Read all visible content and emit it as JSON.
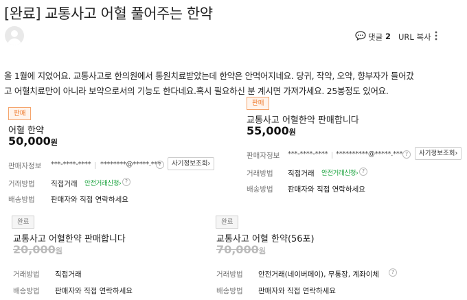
{
  "post": {
    "title": "[완료] 교통사고 어혈 풀어주는 한약",
    "body_line1": "올 1월에 지었어요. 교통사고로 한의원에서 통원치료받았는데 한약은 안먹어지네요. 당귀, 작약, 오약, 향부자가 들어갔",
    "body_line2": "고 어혈치료만이 아니라 보약으로서의 기능도 한다네요.혹시 필요하신 분 계시면 가져가세요. 25봉정도 있어요."
  },
  "toolbar": {
    "comment_label": "댓글",
    "comment_count": "2",
    "url_copy": "URL 복사"
  },
  "labels": {
    "seller_info": "판매자정보",
    "trade_method": "거래방법",
    "delivery_method": "배송방법",
    "fraud_check": "사기정보조회",
    "safe_trade": "안전거래신청",
    "won": "원",
    "help": "?"
  },
  "cards": [
    {
      "badge": "판매",
      "name": "어혈 한약",
      "price": "50,000",
      "seller_phone": "***-****-****",
      "seller_email": "********@*****.***",
      "trade": "직접거래",
      "delivery": "판매자와 직접 연락하세요"
    },
    {
      "badge": "판매",
      "name": "교통사고 어혈한약 판매합니다",
      "price": "55,000",
      "seller_phone": "***-****-****",
      "seller_email": "**********@*****.***",
      "trade": "직접거래",
      "delivery": "판매자와 직접 연락하세요"
    },
    {
      "badge": "완료",
      "name": "교통사고 어혈한약 판매합니다",
      "price": "20,000",
      "trade": "직접거래",
      "delivery": "판매자와 직접 연락하세요"
    },
    {
      "badge": "완료",
      "name": "교통사고 어혈 한약(56포)",
      "price": "70,000",
      "trade": "안전거래(네이버페이), 무통장, 계좌이체",
      "delivery": "판매자와 직접 연락하세요"
    }
  ]
}
